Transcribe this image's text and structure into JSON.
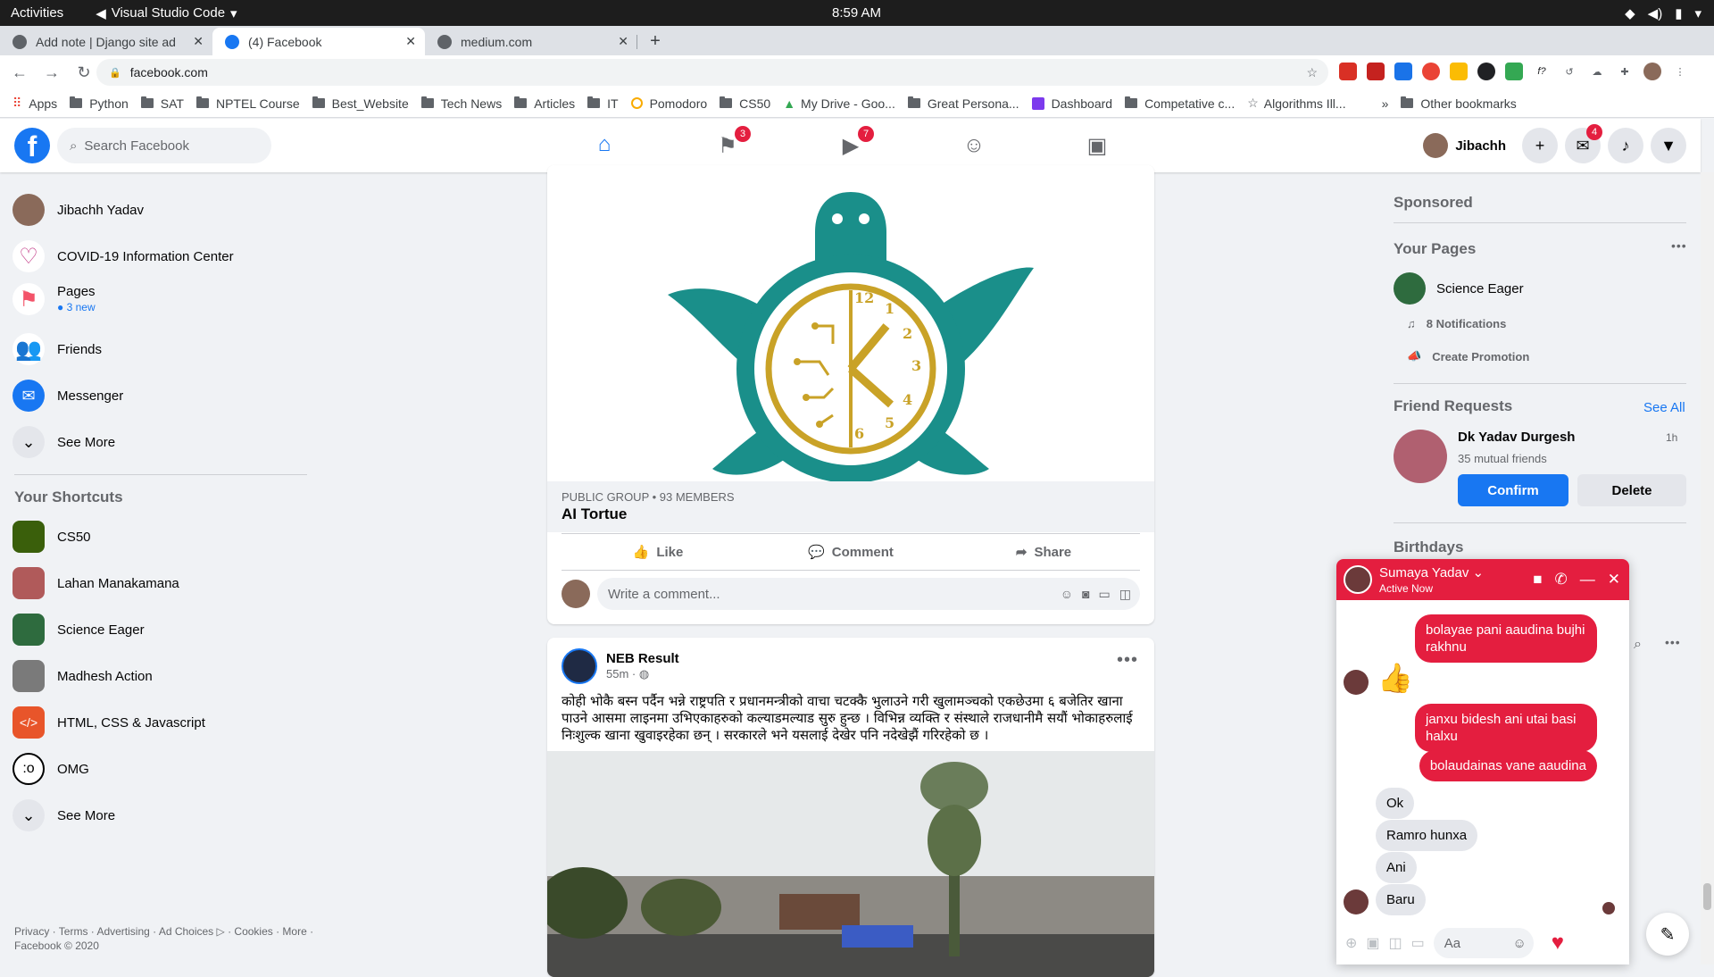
{
  "system": {
    "activities": "Activities",
    "app_name": "Visual Studio Code",
    "clock": "8:59 AM"
  },
  "tabs": [
    {
      "title": "Add note | Django site ad",
      "active": false
    },
    {
      "title": "(4) Facebook",
      "active": true
    },
    {
      "title": "medium.com",
      "active": false
    }
  ],
  "address": {
    "url": "facebook.com"
  },
  "bookmarks": [
    "Apps",
    "Python",
    "SAT",
    "NPTEL Course",
    "Best_Website",
    "Tech News",
    "Articles",
    "IT",
    "Pomodoro",
    "CS50",
    "My Drive - Goo...",
    "Great Persona...",
    "Dashboard",
    "Competative c...",
    "Algorithms Ill...",
    "»",
    "Other bookmarks"
  ],
  "fb": {
    "search_placeholder": "Search Facebook",
    "nav_badges": {
      "pages": "3",
      "watch": "7"
    },
    "profile_name": "Jibachh",
    "messenger_badge": "4",
    "left": {
      "user": "Jibachh Yadav",
      "covid": "COVID-19 Information Center",
      "pages": "Pages",
      "pages_sub": "3 new",
      "friends": "Friends",
      "messenger": "Messenger",
      "see_more_1": "See More",
      "shortcuts_title": "Your Shortcuts",
      "shortcuts": [
        "CS50",
        "Lahan Manakamana",
        "Science Eager",
        "Madhesh Action",
        "HTML, CSS & Javascript",
        "OMG"
      ],
      "see_more_2": "See More",
      "footer": "Privacy · Terms · Advertising · Ad Choices ▷ · Cookies · More · Facebook © 2020"
    },
    "post1": {
      "group_meta": "PUBLIC GROUP • 93 MEMBERS",
      "group_name": "AI Tortue",
      "like": "Like",
      "comment": "Comment",
      "share": "Share",
      "comment_placeholder": "Write a comment..."
    },
    "post2": {
      "author": "NEB Result",
      "time": "55m · ",
      "text": "कोही भोकै बस्न पर्दैन भन्ने राष्ट्रपति र प्रधानमन्त्रीको वाचा चटक्कै भुलाउने गरी खुलामञ्चको एकछेउमा ६ बजेतिर खाना पाउने आसमा लाइनमा उभिएकाहरुको कल्याडमल्याड सुरु हुन्छ । विभिन्न व्यक्ति र संस्थाले राजधानीमै सयौं भोकाहरुलाई निःशुल्क खाना खुवाइरहेका छन् । सरकारले भने यसलाई देखेर पनि नदेखेझैं गरिरहेको छ ।"
    },
    "right": {
      "sponsored": "Sponsored",
      "your_pages": "Your Pages",
      "page_name": "Science Eager",
      "notifications": "8 Notifications",
      "create_promotion": "Create Promotion",
      "friend_requests": "Friend Requests",
      "see_all": "See All",
      "requester": "Dk Yadav Durgesh",
      "req_time": "1h",
      "mutual": "35 mutual friends",
      "confirm": "Confirm",
      "delete": "Delete",
      "birthdays": "Birthdays"
    },
    "chat": {
      "name": "Sumaya Yadav",
      "status": "Active Now",
      "messages": [
        {
          "from": "me",
          "text": "bolayae pani aaudina bujhi rakhnu"
        },
        {
          "from": "me",
          "text": "janxu bidesh ani utai basi halxu"
        },
        {
          "from": "me",
          "text": "bolaudainas vane aaudina"
        },
        {
          "from": "them",
          "text": "Ok"
        },
        {
          "from": "them",
          "text": "Ramro hunxa"
        },
        {
          "from": "them",
          "text": "Ani"
        },
        {
          "from": "them",
          "text": "Baru"
        }
      ],
      "input_placeholder": "Aa"
    }
  },
  "colors": {
    "fb_blue": "#1877f2",
    "chat_red": "#e41e3f",
    "turtle_teal": "#1a8f8a",
    "clock_gold": "#c9a227"
  },
  "logo_digits": [
    "1",
    "2",
    "3",
    "4",
    "5",
    "6",
    "12"
  ]
}
